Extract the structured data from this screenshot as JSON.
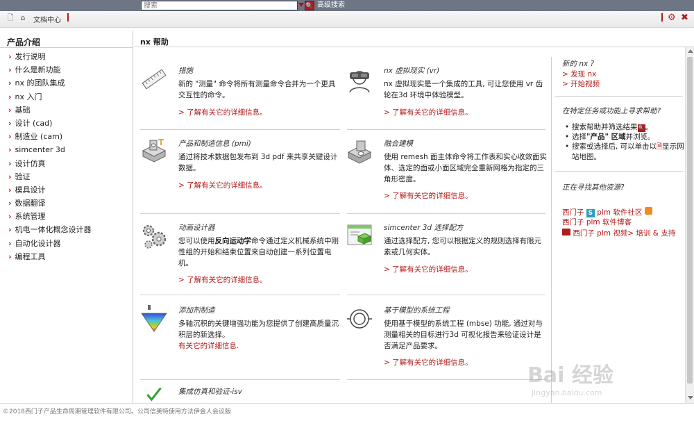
{
  "search": {
    "placeholder": "搜索",
    "advanced_label": "高级搜索"
  },
  "toolbar": {
    "doc_center": "文档中心"
  },
  "sidebar": {
    "title": "产品介绍",
    "items": [
      {
        "label": "发行说明"
      },
      {
        "label": "什么是新功能"
      },
      {
        "label": "nx 的团队集成"
      },
      {
        "label": "nx 入门"
      },
      {
        "label": "基础"
      },
      {
        "label": "设计 (cad)"
      },
      {
        "label": "制造业 (cam)"
      },
      {
        "label": "simcenter 3d"
      },
      {
        "label": "设计仿真"
      },
      {
        "label": "验证"
      },
      {
        "label": "模具设计"
      },
      {
        "label": "数据翻译"
      },
      {
        "label": "系统管理"
      },
      {
        "label": "机电一体化概念设计器"
      },
      {
        "label": "自动化设计器"
      },
      {
        "label": "编程工具"
      }
    ]
  },
  "main": {
    "title": "nx 帮助",
    "cards": [
      {
        "title": "措施",
        "desc": "新的 \"测量\" 命令将所有测量命令合并为一个更具交互性的命令。",
        "more": "> 了解有关它的详细信息。",
        "icon": "ruler-icon"
      },
      {
        "title": "nx 虚拟现实 (vr)",
        "desc": "nx 虚拟现实是一个集成的工具, 可让您使用 vr 齿轮在3d 环境中体验模型。",
        "more": "> 了解有关它的详细信息。",
        "icon": "vr-headset-icon"
      },
      {
        "title": "产品和制造信息 (pmi)",
        "desc": "通过将技术数据包发布到 3d pdf 来共享关键设计数据。",
        "more": "> 了解有关它的详细信息。",
        "icon": "pmi-part-icon"
      },
      {
        "title": "融合建模",
        "desc": "使用 remesh 面主体命令将工作表和实心收敛面实体、选定的面或小面区域完全重新网格为指定的三角形密度。",
        "more": "> 了解有关它的详细信息。",
        "icon": "part-model-icon"
      },
      {
        "title": "动画设计器",
        "desc_pre": "您可以使用",
        "desc_bold": "反向运动学",
        "desc_post": "命令通过定义机械系统中刚性组的开始和结束位置来自动创建一系列位置电机。",
        "more": "> 了解有关它的详细信息。",
        "icon": "gears-icon"
      },
      {
        "title": "simcenter 3d 选择配方",
        "desc": "通过选择配方, 您可以根据定义的规则选择有限元素或几何实体。",
        "more": "> 了解有关它的详细信息。",
        "icon": "selection-recipe-icon"
      },
      {
        "title": "添加剂制造",
        "desc": "多轴沉积的关键增强功能为您提供了创建高质量沉积层的新选择。",
        "more": "有关它的详细信息.",
        "icon": "additive-cone-icon"
      },
      {
        "title": "基于模型的系统工程",
        "desc": "使用基于模型的系统工程 (mbse) 功能, 通过对与测量相关的目标进行3d 可视化报告来验证设计是否满足产品要求。",
        "more": "> 了解有关它的详细信息。",
        "icon": "mbse-icon"
      },
      {
        "title": "集成仿真和验证-isv",
        "icon": "check-icon"
      }
    ]
  },
  "right": {
    "new_q": "新的 nx ?",
    "links1": [
      "> 发现 nx",
      "> 开始视频"
    ],
    "help_q": "在特定任务或功能上寻求帮助?",
    "bullets": [
      {
        "pre": "搜索帮助并筛选结果",
        "post": "。"
      },
      {
        "pre": "选择",
        "bold": "\"产品\" 区域",
        "post": "并浏览。"
      },
      {
        "pre": "搜索或选择后, 可以单击以",
        "post": "显示网站地图。"
      }
    ],
    "other_q": "正在寻找其他资源?",
    "res1": "西门子",
    "res2": "plm 软件社区",
    "res3": "西门子 plm 软件博客",
    "res4": "西门子 plm 视频> 培训 & 支持"
  },
  "footer": {
    "text": "©2018西门子产品生命周期管理软件有限公司。公司信美特使用方法伊金人会议版"
  },
  "watermark": {
    "text": "Bai  经验",
    "url": "jingyan.baidu.com"
  },
  "colors": {
    "accent": "#b11b1b",
    "topbar": "#6e7685"
  }
}
